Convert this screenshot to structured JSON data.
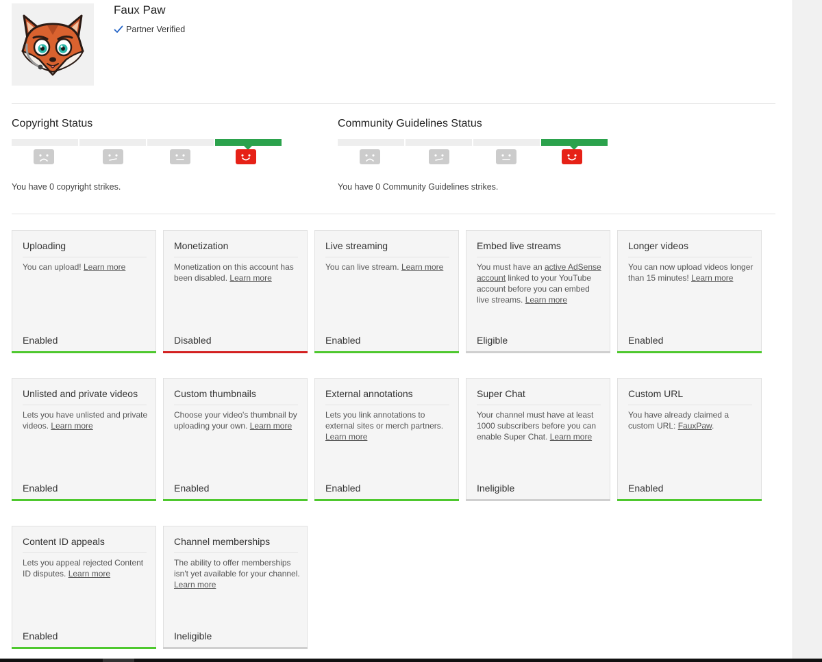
{
  "channel": {
    "name": "Faux Paw",
    "verified_label": "Partner Verified"
  },
  "copyright": {
    "title": "Copyright Status",
    "text": "You have 0 copyright strikes.",
    "strikes": 0
  },
  "community": {
    "title": "Community Guidelines Status",
    "text": "You have 0 Community Guidelines strikes.",
    "strikes": 0
  },
  "colors": {
    "enabled": "#4ec82e",
    "disabled": "#d32020",
    "neutral": "#cfcfcf",
    "active_strike": "#2ba24c",
    "face_active": "#e62117",
    "face_inactive": "#cccccc"
  },
  "features": [
    {
      "title": "Uploading",
      "desc": [
        {
          "text": "You can upload! "
        },
        {
          "link": "Learn more"
        }
      ],
      "status": "Enabled",
      "state": "green"
    },
    {
      "title": "Monetization",
      "desc": [
        {
          "text": "Monetization on this account has been disabled. "
        },
        {
          "link": "Learn more"
        }
      ],
      "status": "Disabled",
      "state": "red"
    },
    {
      "title": "Live streaming",
      "desc": [
        {
          "text": "You can live stream. "
        },
        {
          "link": "Learn more"
        }
      ],
      "status": "Enabled",
      "state": "green"
    },
    {
      "title": "Embed live streams",
      "desc": [
        {
          "text": "You must have an "
        },
        {
          "link": "active AdSense account"
        },
        {
          "text": " linked to your YouTube account before you can embed live streams. "
        },
        {
          "link": "Learn more"
        }
      ],
      "status": "Eligible",
      "state": "gray"
    },
    {
      "title": "Longer videos",
      "desc": [
        {
          "text": "You can now upload videos longer than 15 minutes! "
        },
        {
          "link": "Learn more"
        }
      ],
      "status": "Enabled",
      "state": "green"
    },
    {
      "title": "Unlisted and private videos",
      "desc": [
        {
          "text": "Lets you have unlisted and private videos. "
        },
        {
          "link": "Learn more"
        }
      ],
      "status": "Enabled",
      "state": "green"
    },
    {
      "title": "Custom thumbnails",
      "desc": [
        {
          "text": "Choose your video's thumbnail by uploading your own. "
        },
        {
          "link": "Learn more"
        }
      ],
      "status": "Enabled",
      "state": "green"
    },
    {
      "title": "External annotations",
      "desc": [
        {
          "text": "Lets you link annotations to external sites or merch partners. "
        },
        {
          "link": "Learn more"
        }
      ],
      "status": "Enabled",
      "state": "green"
    },
    {
      "title": "Super Chat",
      "desc": [
        {
          "text": "Your channel must have at least 1000 subscribers before you can enable Super Chat. "
        },
        {
          "link": "Learn more"
        }
      ],
      "status": "Ineligible",
      "state": "gray"
    },
    {
      "title": "Custom URL",
      "desc": [
        {
          "text": "You have already claimed a custom URL: "
        },
        {
          "link": "FauxPaw"
        },
        {
          "text": "."
        }
      ],
      "status": "Enabled",
      "state": "green"
    },
    {
      "title": "Content ID appeals",
      "desc": [
        {
          "text": "Lets you appeal rejected Content ID disputes. "
        },
        {
          "link": "Learn more"
        }
      ],
      "status": "Enabled",
      "state": "green"
    },
    {
      "title": "Channel memberships",
      "desc": [
        {
          "text": "The ability to offer memberships isn't yet available for your channel. "
        },
        {
          "link": "Learn more"
        }
      ],
      "status": "Ineligible",
      "state": "gray"
    }
  ]
}
